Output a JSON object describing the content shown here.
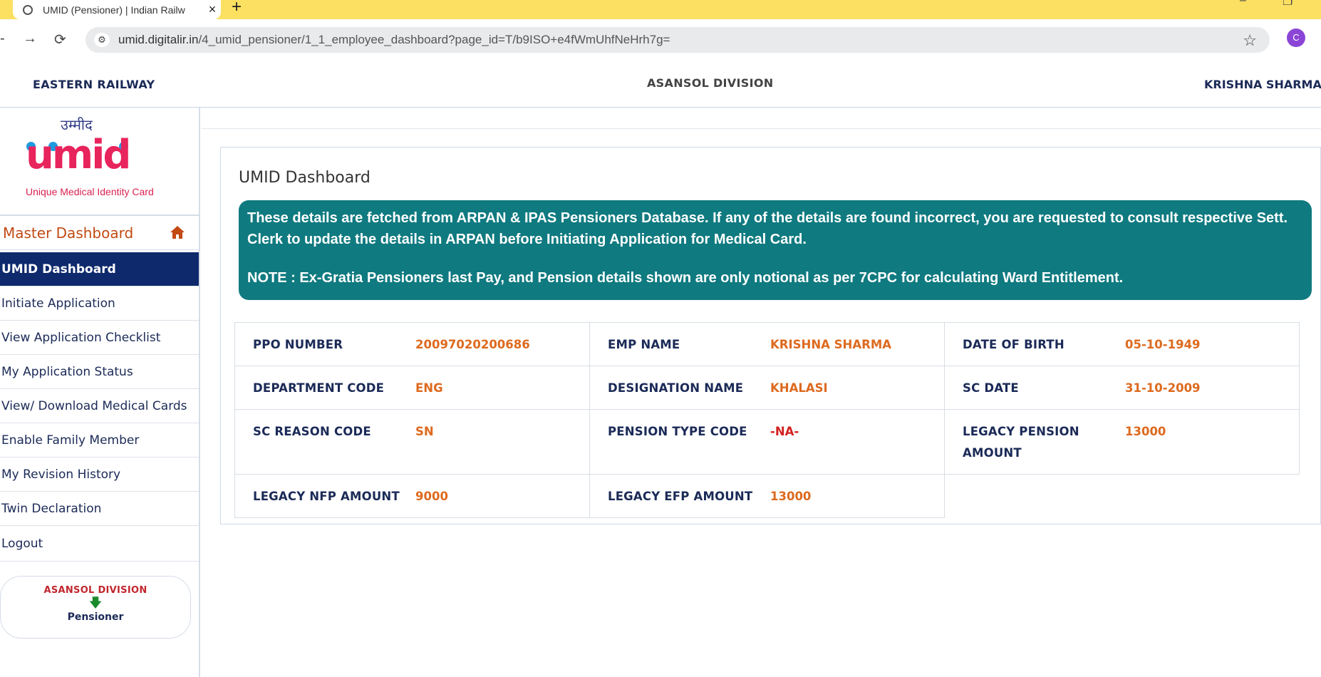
{
  "browser": {
    "tab_title": "UMID (Pensioner) | Indian Railw",
    "url_host": "umid.digitalir.in",
    "url_path": "/4_umid_pensioner/1_1_employee_dashboard?page_id=T/b9ISO+e4fWmUhfNeHrh7g=",
    "profile_initial": "C"
  },
  "header": {
    "org": "EASTERN RAILWAY",
    "division": "ASANSOL DIVISION",
    "user": "KRISHNA SHARMA"
  },
  "logo": {
    "hindi": "उम्मीद",
    "word": "umid",
    "tagline": "Unique Medical Identity Card"
  },
  "sidebar": {
    "master": "Master Dashboard",
    "items": [
      "UMID Dashboard",
      "Initiate Application",
      "View Application Checklist",
      "My Application Status",
      "View/ Download Medical Cards",
      "Enable Family Member",
      "My Revision History",
      "Twin Declaration",
      "Logout"
    ],
    "badge_division": "ASANSOL DIVISION",
    "badge_role": "Pensioner"
  },
  "main": {
    "title": "UMID Dashboard",
    "notice_1": "These details are fetched from ARPAN & IPAS Pensioners Database.  If any of the details are found incorrect, you are requested to consult respective Sett. Clerk to update the details in ARPAN before Initiating Application for Medical Card.",
    "notice_2": "NOTE : Ex-Gratia Pensioners last Pay, and Pension details shown are only notional as per 7CPC for calculating Ward Entitlement.",
    "fields": {
      "ppo_label": "PPO NUMBER",
      "ppo_value": "20097020200686",
      "emp_label": "EMP NAME",
      "emp_value": "KRISHNA SHARMA",
      "dob_label": "DATE OF BIRTH",
      "dob_value": "05-10-1949",
      "dept_label": "DEPARTMENT CODE",
      "dept_value": "ENG",
      "desig_label": "DESIGNATION NAME",
      "desig_value": "KHALASI",
      "scdate_label": "SC DATE",
      "scdate_value": "31-10-2009",
      "screason_label": "SC REASON CODE",
      "screason_value": "SN",
      "pension_type_label": "PENSION TYPE CODE",
      "pension_type_value": "-NA-",
      "legacy_pension_label": "LEGACY PENSION AMOUNT",
      "legacy_pension_value": "13000",
      "nfp_label": "LEGACY NFP AMOUNT",
      "nfp_value": "9000",
      "efp_label": "LEGACY EFP AMOUNT",
      "efp_value": "13000"
    }
  },
  "colors": {
    "tab_strip": "#fbe062",
    "nav_active": "#0e2a6d",
    "notice_bg": "#0f7a80",
    "value_orange": "#dd6a1f",
    "label_navy": "#1b2a57"
  }
}
